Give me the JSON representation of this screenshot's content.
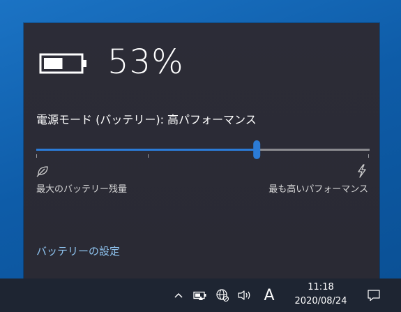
{
  "battery": {
    "percent_text": "53%",
    "level": 0.53
  },
  "power_mode": {
    "label": "電源モード (バッテリー): 高パフォーマンス",
    "slider_position": 0.7,
    "left_caption": "最大のバッテリー残量",
    "right_caption": "最も高いパフォーマンス",
    "left_icon": "leaf-icon",
    "right_icon": "lightning-bolt-icon"
  },
  "settings_link": "バッテリーの設定",
  "taskbar": {
    "tray_icons": [
      "chevron-up-icon",
      "battery-icon",
      "network-globe-icon",
      "volume-icon"
    ],
    "ime_indicator": "A",
    "time": "11:18",
    "date": "2020/08/24",
    "notification_icon": "notification-icon"
  },
  "colors": {
    "accent": "#2b7bd6",
    "flyout_bg": "#2b2b35",
    "link": "#8fc4f0",
    "taskbar_bg": "#1e2532"
  }
}
